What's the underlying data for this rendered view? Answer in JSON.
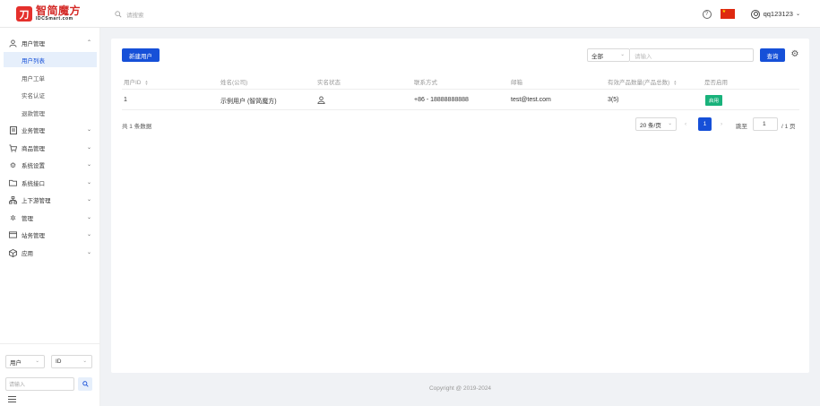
{
  "header": {
    "logo_cn": "智简魔方",
    "logo_en": "IDCSmart.com",
    "search_placeholder": "请搜索",
    "username": "qq123123"
  },
  "sidebar": {
    "groups": [
      {
        "label": "用户管理",
        "icon": "user-icon",
        "expanded": true
      },
      {
        "label": "业务管理",
        "icon": "document-icon"
      },
      {
        "label": "商品管理",
        "icon": "cart-icon"
      },
      {
        "label": "系统设置",
        "icon": "gear-icon"
      },
      {
        "label": "系统接口",
        "icon": "folder-icon"
      },
      {
        "label": "上下游管理",
        "icon": "hierarchy-icon"
      },
      {
        "label": "管理",
        "icon": "grid-icon"
      },
      {
        "label": "站务管理",
        "icon": "window-icon"
      },
      {
        "label": "应用",
        "icon": "box-icon"
      }
    ],
    "user_sub": [
      "用户列表",
      "用户工单",
      "实名认证",
      "退款管理"
    ],
    "active_sub": "用户列表",
    "bottom": {
      "type_select": "用户",
      "field_select": "ID",
      "input_placeholder": "请输入"
    }
  },
  "toolbar": {
    "new_user": "新建用户",
    "filter_select": "全部",
    "filter_placeholder": "请输入",
    "query": "查询"
  },
  "table": {
    "columns": [
      "用户ID",
      "姓名(公司)",
      "实名状态",
      "联系方式",
      "邮箱",
      "有效产品数量(产品总数)",
      "是否启用"
    ],
    "rows": [
      {
        "id": "1",
        "name": "示例用户 (智简魔方)",
        "contact": "+86 - 18888888888",
        "email": "test@test.com",
        "products": "3(5)",
        "status": "启用"
      }
    ]
  },
  "pagination": {
    "total": "共 1 条数据",
    "page_size": "20 条/页",
    "current": "1",
    "jump_label": "跳至",
    "jump_value": "1",
    "total_pages": "/ 1 页"
  },
  "footer": {
    "copyright": "Copyright @ 2019-2024"
  },
  "colors": {
    "primary": "#1650d8",
    "brand": "#e5302c",
    "success": "#19b27b"
  }
}
